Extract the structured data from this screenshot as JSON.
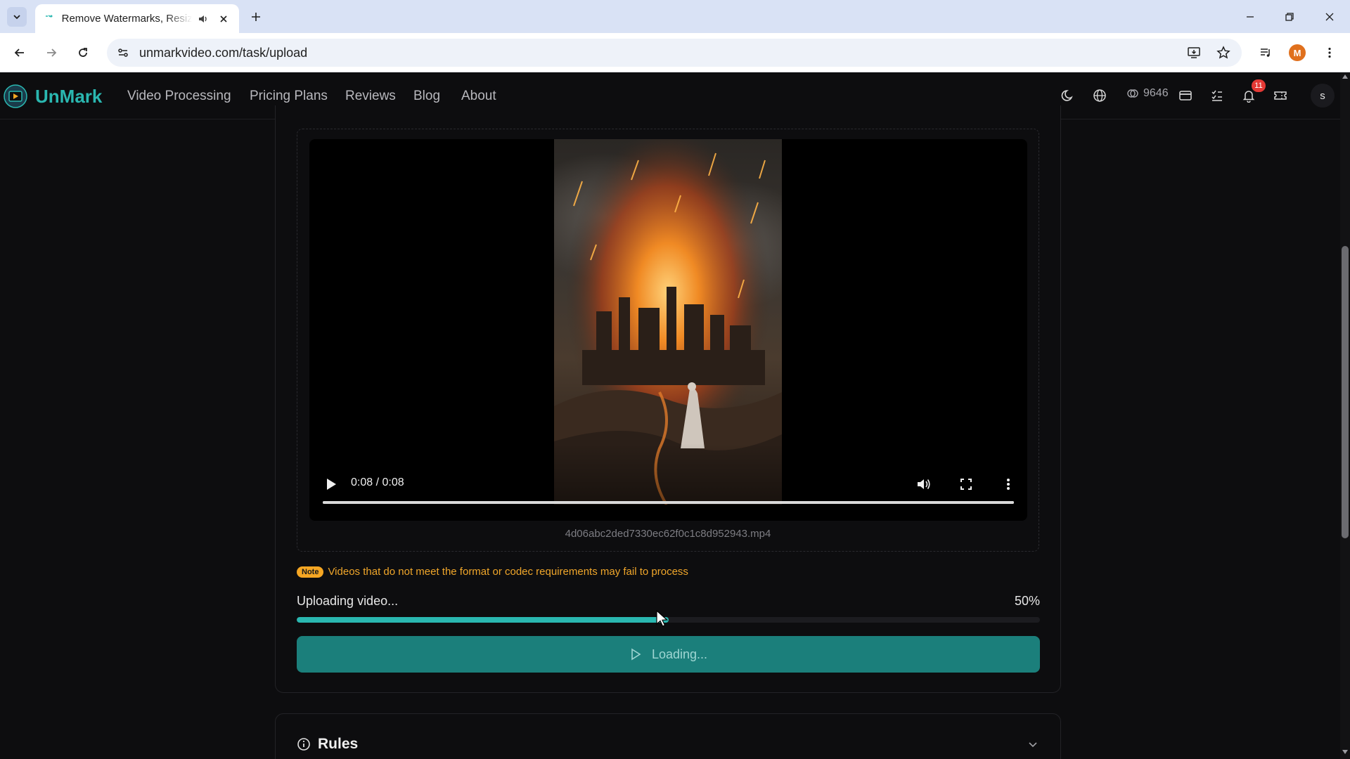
{
  "browser": {
    "tab_title": "Remove Watermarks, Resize Videos",
    "url": "unmarkvideo.com/task/upload",
    "profile_initial": "M"
  },
  "site": {
    "logo_text": "UnMark",
    "nav": [
      "Video Processing",
      "Pricing Plans",
      "Reviews",
      "Blog",
      "About"
    ],
    "credits": "9646",
    "notification_count": "11",
    "avatar_initial": "s"
  },
  "video": {
    "time": "0:08 / 0:08",
    "filename": "4d06abc2ded7330ec62f0c1c8d952943.mp4",
    "progress_fraction": 1.0
  },
  "note": {
    "badge": "Note",
    "text": "Videos that do not meet the format or codec requirements may fail to process"
  },
  "upload": {
    "label": "Uploading video...",
    "percent_text": "50%",
    "progress_fraction": 0.5
  },
  "submit": {
    "label": "Loading..."
  },
  "rules": {
    "title": "Rules"
  },
  "colors": {
    "accent": "#2ab7b0",
    "button": "#1b7f7b",
    "note": "#f5a623",
    "background": "#0d0d0f"
  }
}
